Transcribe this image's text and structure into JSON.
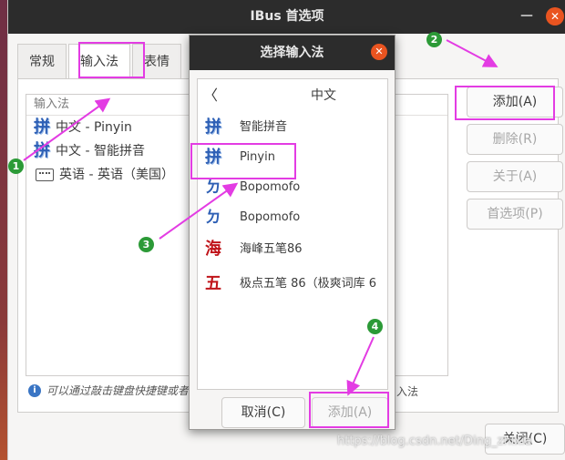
{
  "main_window": {
    "title": "IBus 首选项",
    "close_glyph": "✕",
    "minimize_glyph": "—"
  },
  "tabs": [
    {
      "label": "常规"
    },
    {
      "label": "输入法"
    },
    {
      "label": "表情"
    }
  ],
  "im_list": {
    "header": "输入法",
    "items": [
      {
        "label": "中文 - Pinyin",
        "icon": "pinyin-icon"
      },
      {
        "label": "中文 - 智能拼音",
        "icon": "pinyin-icon"
      },
      {
        "label": "英语 - 英语（美国）",
        "icon": "keyboard-icon"
      }
    ]
  },
  "buttons": {
    "add": "添加(A)",
    "remove": "删除(R)",
    "about": "关于(A)",
    "preferences": "首选项(P)",
    "close": "关闭(C)"
  },
  "info_text": "可以通过敲击键盘快捷键或者",
  "info_tail": "入法",
  "dialog": {
    "title": "选择输入法",
    "back_glyph": "〈",
    "language": "中文",
    "items": [
      {
        "label": "智能拼音",
        "icon_glyph": "拼"
      },
      {
        "label": "Pinyin",
        "icon_glyph": "拼"
      },
      {
        "label": "Bopomofo",
        "icon_glyph": "ㄉ"
      },
      {
        "label": "Bopomofo",
        "icon_glyph": "ㄉ"
      },
      {
        "label": "海峰五笔86",
        "icon_glyph": "海"
      },
      {
        "label": "极点五笔 86（极爽词库 6",
        "icon_glyph": "五"
      }
    ],
    "cancel": "取消(C)",
    "add": "添加(A)"
  },
  "steps": [
    "1",
    "2",
    "3",
    "4"
  ],
  "watermark": "https://blog.csdn.net/Ding_zhixia",
  "colors": {
    "annotation": "#e33ce3",
    "step_badge": "#2c9a37",
    "close_button": "#e95420"
  }
}
